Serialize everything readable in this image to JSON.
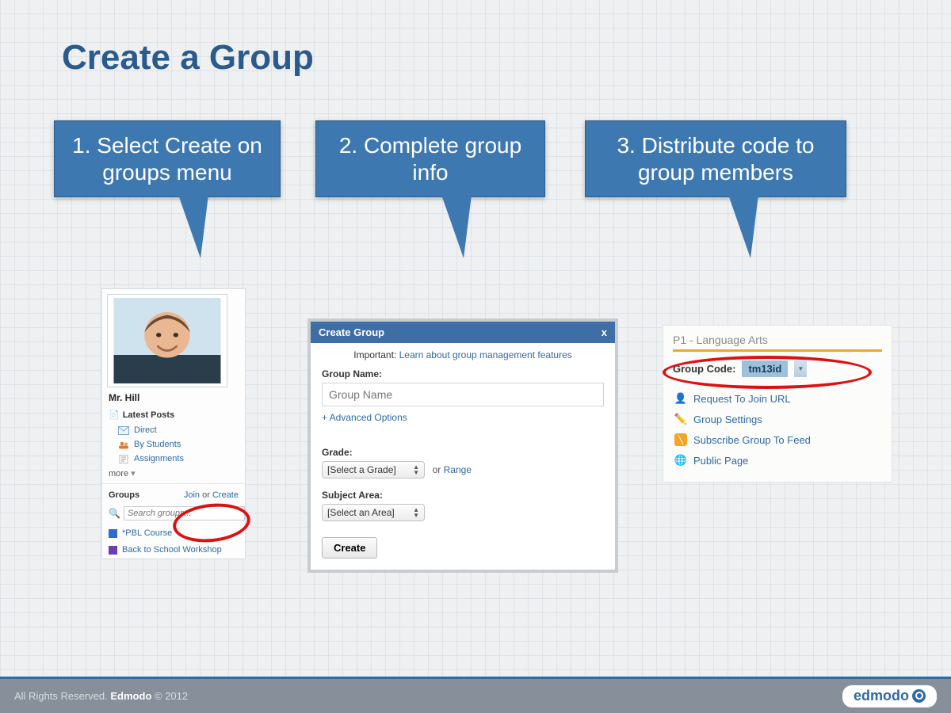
{
  "title": "Create a Group",
  "callouts": {
    "c1": "1. Select Create on groups menu",
    "c2": "2. Complete group info",
    "c3": "3. Distribute code to group members"
  },
  "sidebar": {
    "username": "Mr. Hill",
    "posts_header": "Latest Posts",
    "items": {
      "direct": "Direct",
      "by_students": "By Students",
      "assignments": "Assignments",
      "more": "more"
    },
    "groups_label": "Groups",
    "join_label": "Join",
    "or_label": "or",
    "create_label": "Create",
    "search_placeholder": "Search groups...",
    "group1": "*PBL Course",
    "group2": "Back to School Workshop"
  },
  "dialog": {
    "header": "Create Group",
    "close": "x",
    "important_prefix": "Important: ",
    "important_link": "Learn about group management features",
    "group_name_label": "Group Name:",
    "group_name_placeholder": "Group Name",
    "advanced": "+ Advanced Options",
    "grade_label": "Grade:",
    "grade_select": "[Select a Grade]",
    "or": " or ",
    "range": "Range",
    "subject_label": "Subject Area:",
    "subject_select": "[Select an Area]",
    "create_btn": "Create"
  },
  "group_panel": {
    "title": "P1 - Language Arts",
    "code_label": "Group Code:",
    "code_value": "tm13id",
    "link_join": "Request To Join URL",
    "link_settings": "Group Settings",
    "link_subscribe": "Subscribe Group To Feed",
    "link_public": "Public Page"
  },
  "footer": {
    "text_prefix": "All Rights Reserved. ",
    "brand": "Edmodo",
    "text_suffix": " © 2012",
    "logo_text": "edmodo"
  },
  "colors": {
    "blue": "#3d79b0",
    "orange": "#f5a423",
    "red": "#d11"
  }
}
